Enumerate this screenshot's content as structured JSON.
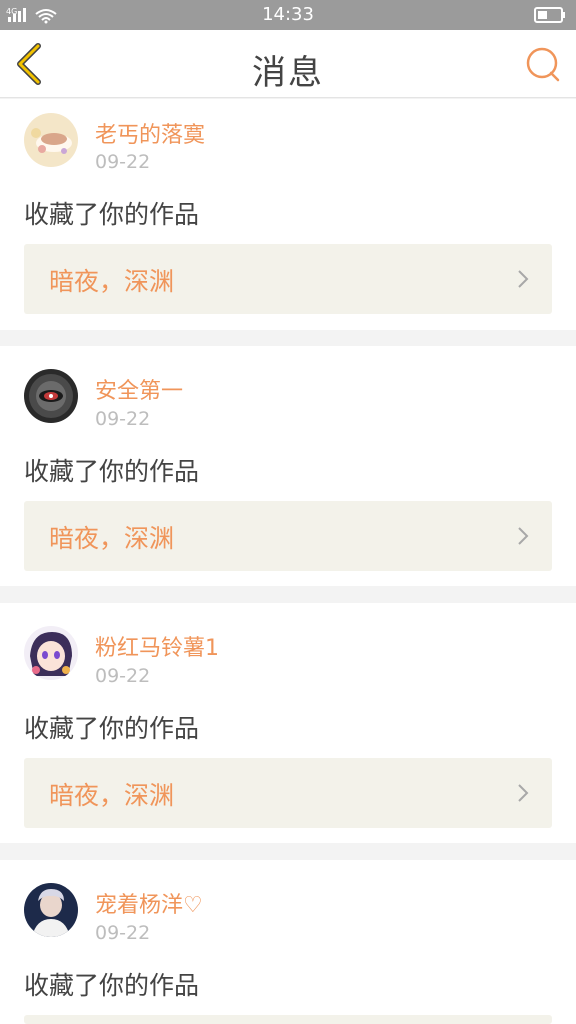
{
  "status_bar": {
    "network": "4G",
    "time": "14:33"
  },
  "header": {
    "title": "消息",
    "back_icon": "back-chevron-icon",
    "search_icon": "search-icon",
    "accent_color": "#f0955a"
  },
  "messages": [
    {
      "username": "老丐的落寞",
      "date": "09-22",
      "action": "收藏了你的作品",
      "work_title": "暗夜，深渊",
      "avatar": "teacup-avatar"
    },
    {
      "username": "安全第一",
      "date": "09-22",
      "action": "收藏了你的作品",
      "work_title": "暗夜，深渊",
      "avatar": "eye-avatar"
    },
    {
      "username": "粉红马铃薯1",
      "date": "09-22",
      "action": "收藏了你的作品",
      "work_title": "暗夜，深渊",
      "avatar": "anime-girl-avatar"
    },
    {
      "username": "宠着杨洋♡",
      "date": "09-22",
      "action": "收藏了你的作品",
      "work_title": "",
      "avatar": "portrait-avatar"
    }
  ]
}
